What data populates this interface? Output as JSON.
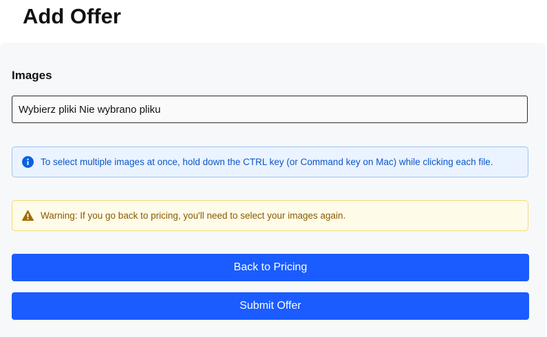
{
  "page": {
    "title": "Add Offer"
  },
  "images_section": {
    "label": "Images",
    "file_input": {
      "button_label": "Wybierz pliki",
      "status_text": "Nie wybrano pliku"
    }
  },
  "info_alert": {
    "icon": "info-icon",
    "text": "To select multiple images at once, hold down the CTRL key (or Command key on Mac) while clicking each file.",
    "color": "#0b56c9",
    "background": "#eaf3ff"
  },
  "warning_alert": {
    "icon": "warning-icon",
    "text": "Warning: If you go back to pricing, you'll need to select your images again.",
    "color": "#8a5a00",
    "background": "#fefbe8"
  },
  "actions": {
    "back_label": "Back to Pricing",
    "submit_label": "Submit Offer",
    "button_color": "#1a5cff"
  }
}
